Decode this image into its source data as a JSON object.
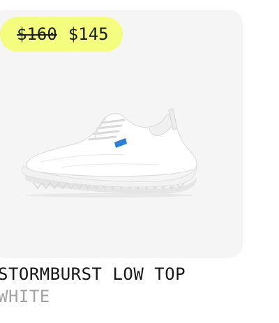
{
  "product": {
    "price_original": "$160",
    "price_sale": "$145",
    "name": "STORMBURST LOW TOP",
    "color": "WHITE",
    "image_icon": "sneaker-image"
  },
  "colors": {
    "badge_bg": "#f4fd7d",
    "card_bg": "#f5f5f5",
    "name_text": "#161616",
    "color_text": "#a3a3a3",
    "accent_tab": "#2a7fd6"
  }
}
